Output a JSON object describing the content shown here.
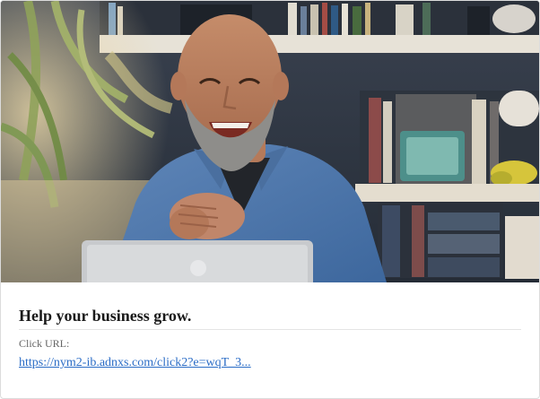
{
  "ad": {
    "image_alt": "Smiling man with a beard in a denim shirt, hands clasped, in front of a laptop and bookshelves",
    "headline": "Help your business grow.",
    "click_url_label": "Click URL:",
    "click_url_text": "https://nym2-ib.adnxs.com/click2?e=wqT_3..."
  },
  "colors": {
    "link": "#2a6cc6",
    "headline": "#1a1a1a",
    "label": "#666666",
    "border": "#dcdcdc"
  }
}
